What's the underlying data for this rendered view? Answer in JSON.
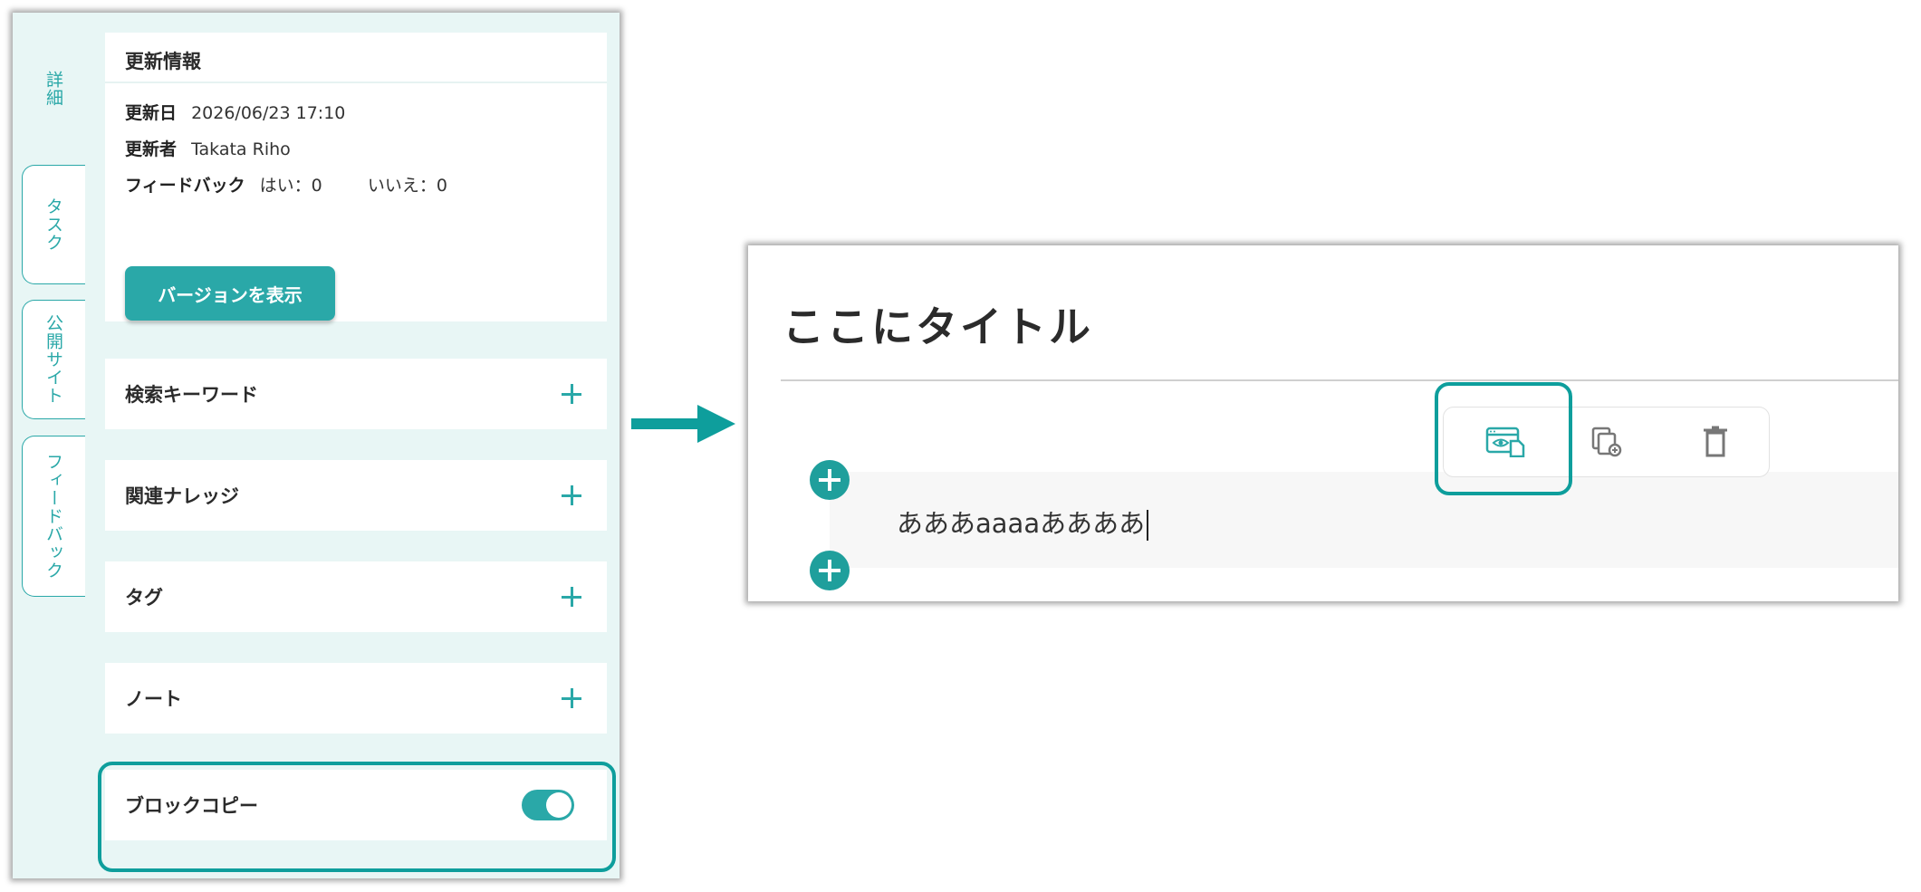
{
  "left_panel": {
    "tabs": [
      {
        "label": "詳細",
        "active": true
      },
      {
        "label": "タスク",
        "active": false
      },
      {
        "label": "公開サイト",
        "active": false
      },
      {
        "label": "フィードバック",
        "active": false
      }
    ],
    "update_info": {
      "title": "更新情報",
      "date_label": "更新日",
      "date_value": "2026/06/23 17:10",
      "updater_label": "更新者",
      "updater_value": "Takata Riho",
      "feedback_label": "フィードバック",
      "feedback_yes": "はい：0",
      "feedback_no": "いいえ：0",
      "version_button": "バージョンを表示"
    },
    "sections": [
      {
        "label": "検索キーワード"
      },
      {
        "label": "関連ナレッジ"
      },
      {
        "label": "タグ"
      },
      {
        "label": "ノート"
      }
    ],
    "block_copy": {
      "label": "ブロックコピー",
      "enabled": true
    }
  },
  "editor": {
    "title": "ここにタイトル",
    "block_text": "あああaaaaああああ",
    "toolbar": {
      "buttons": [
        {
          "icon": "preview-copy-icon",
          "highlighted": true
        },
        {
          "icon": "duplicate-icon"
        },
        {
          "icon": "trash-icon"
        }
      ]
    }
  },
  "colors": {
    "accent": "#2aa8a8",
    "highlight": "#0e9e9c",
    "panel_bg": "#e8f6f5"
  }
}
